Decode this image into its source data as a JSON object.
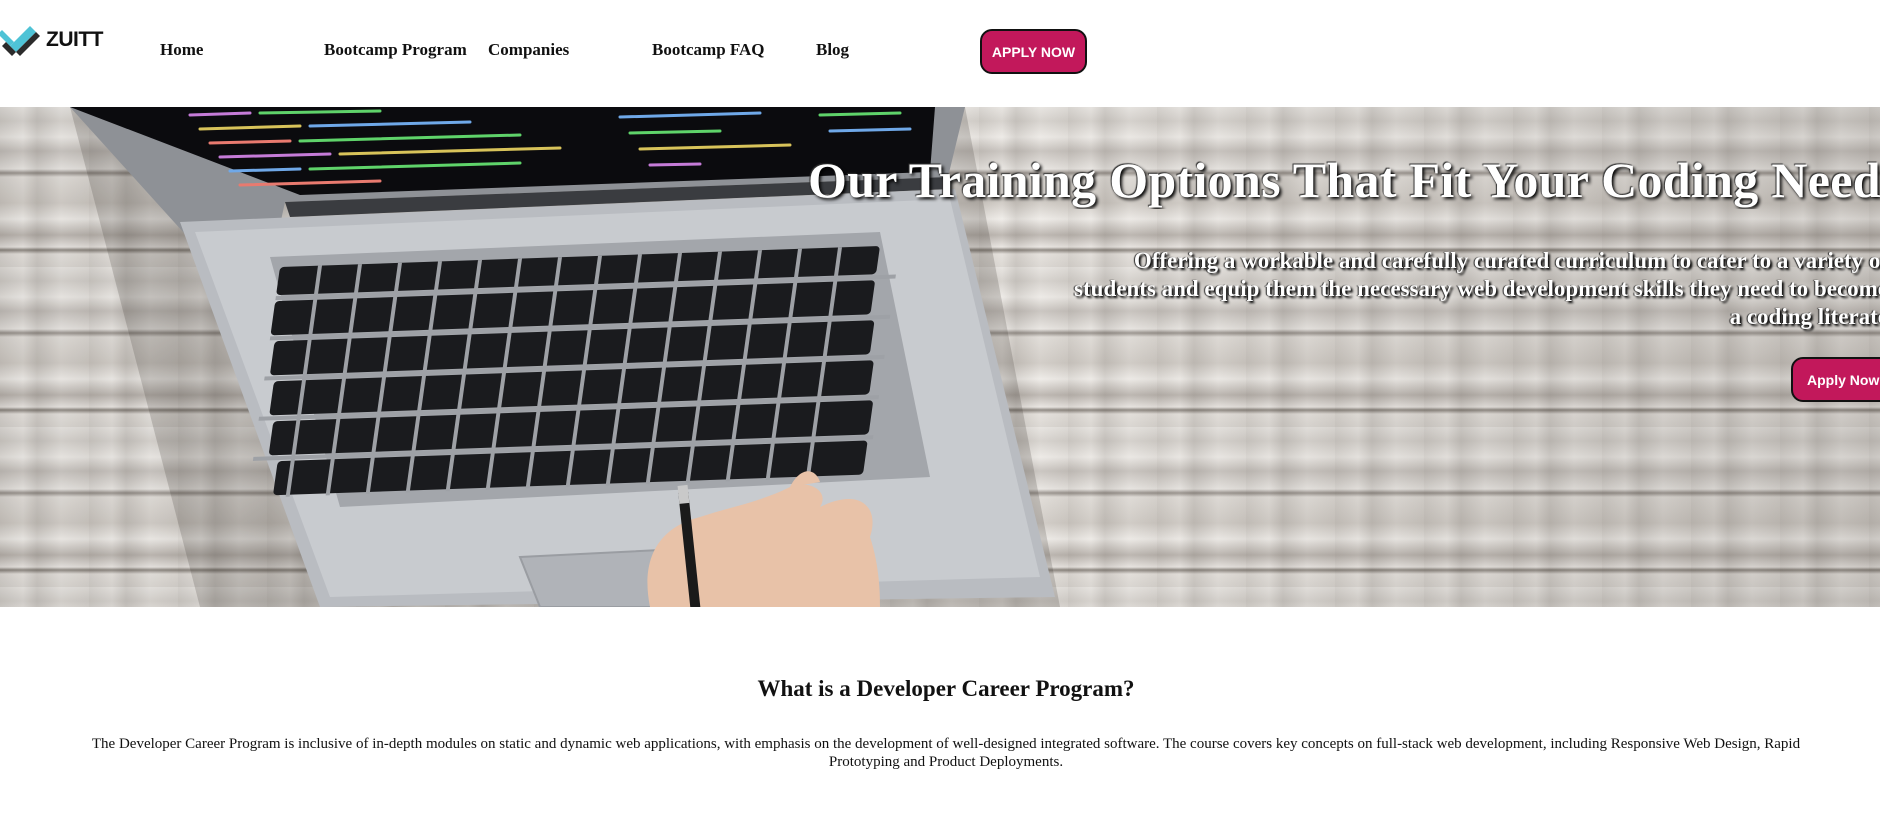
{
  "brand": {
    "name": "ZUITT",
    "logo_colors": [
      "#4fc3d6",
      "#2b2b2b"
    ]
  },
  "nav": {
    "items": [
      {
        "label": "Home"
      },
      {
        "label": "Bootcamp Program"
      },
      {
        "label": "Companies"
      },
      {
        "label": "Bootcamp FAQ"
      },
      {
        "label": "Blog"
      }
    ],
    "apply_label": "APPLY NOW"
  },
  "hero": {
    "title": "Our Training Options That Fit Your Coding Needs",
    "description_lines": [
      "Offering a workable and carefully curated curriculum to cater to a variety of",
      "students and equip them the necessary web development skills they need to become",
      "a coding literate"
    ],
    "apply_label": "Apply Now",
    "background_image": "laptop-on-wood-desk"
  },
  "program": {
    "heading": "What is a Developer Career Program?",
    "description_lines": [
      "The Developer Career Program is inclusive of in-depth modules on static and dynamic web applications, with emphasis on the development of well-designed integrated software. The course covers key concepts on full-stack web development, including Responsive Web Design, Rapid",
      "Prototyping and Product Deployments."
    ]
  },
  "colors": {
    "accent": "#c2185b",
    "text": "#111111"
  }
}
